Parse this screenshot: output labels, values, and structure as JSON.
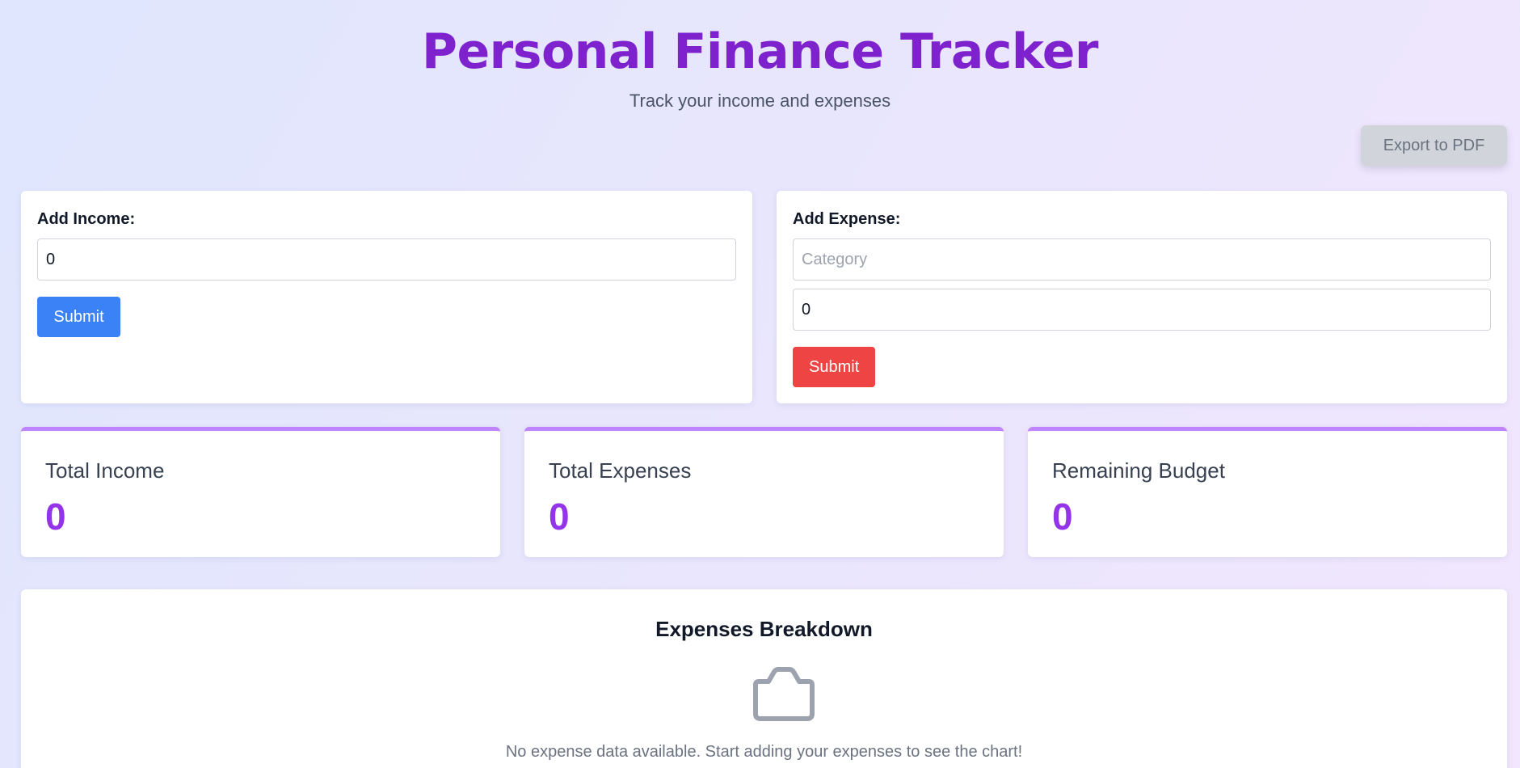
{
  "header": {
    "title": "Personal Finance Tracker",
    "subtitle": "Track your income and expenses"
  },
  "toolbar": {
    "export_label": "Export to PDF"
  },
  "income_form": {
    "label": "Add Income:",
    "amount_value": "0",
    "submit_label": "Submit"
  },
  "expense_form": {
    "label": "Add Expense:",
    "category_placeholder": "Category",
    "category_value": "",
    "amount_value": "0",
    "submit_label": "Submit"
  },
  "stats": [
    {
      "label": "Total Income",
      "value": "0"
    },
    {
      "label": "Total Expenses",
      "value": "0"
    },
    {
      "label": "Remaining Budget",
      "value": "0"
    }
  ],
  "breakdown": {
    "title": "Expenses Breakdown",
    "icon": "empty-box-icon",
    "empty_message": "No expense data available. Start adding your expenses to see the chart!"
  },
  "colors": {
    "brand": "#7e22ce",
    "accent_value": "#9333ea",
    "income_button": "#3b82f6",
    "expense_button": "#ef4444",
    "stat_border": "#c084fc"
  }
}
